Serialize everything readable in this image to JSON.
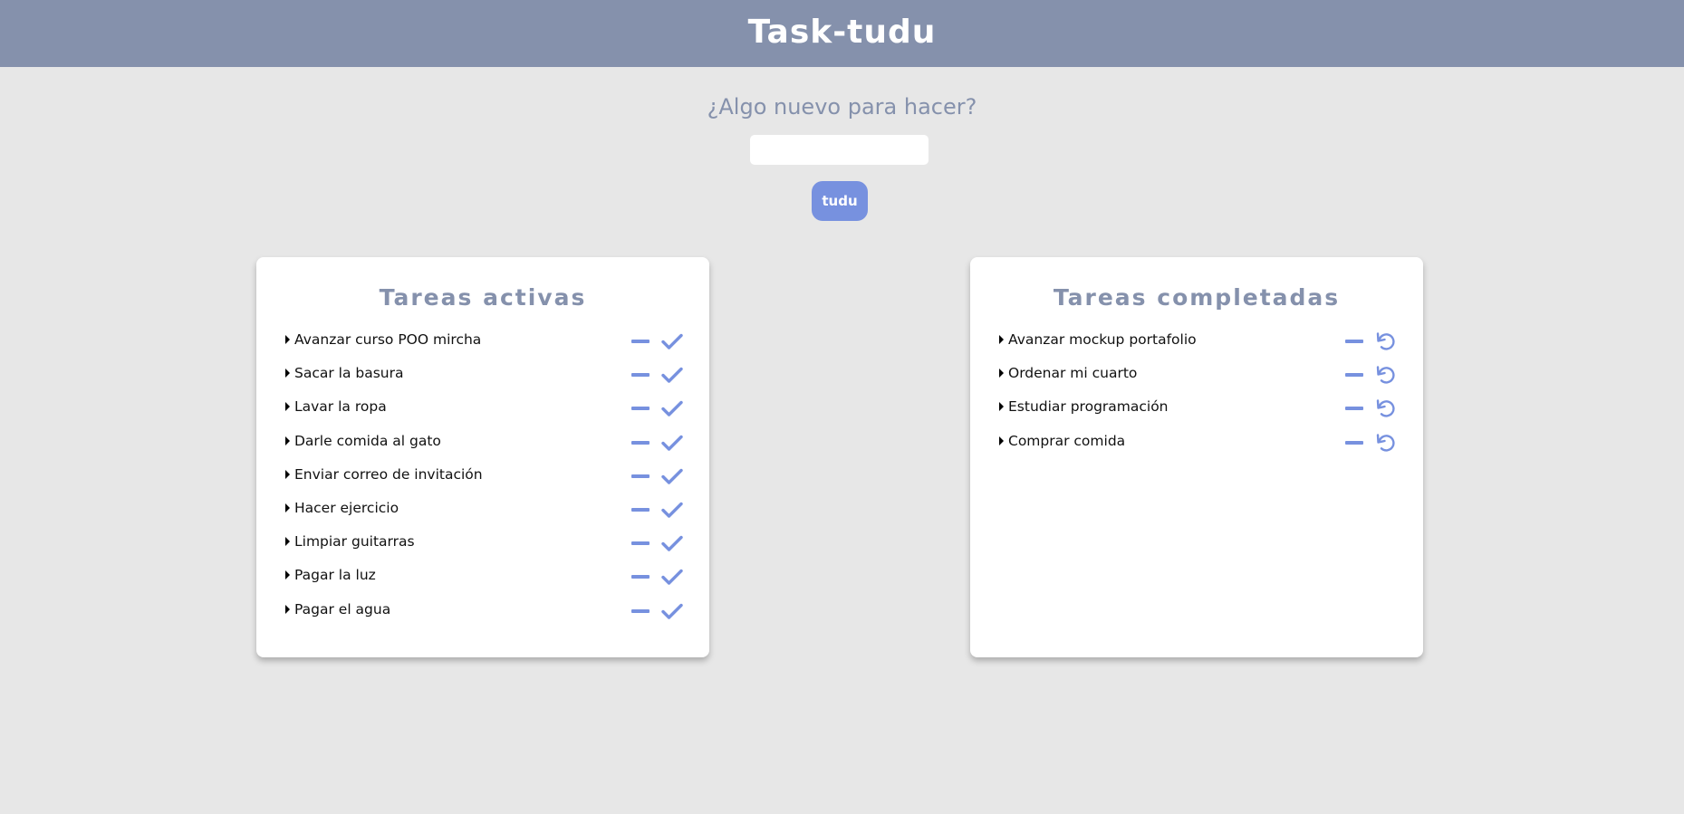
{
  "header": {
    "title": "Task-tudu"
  },
  "form": {
    "prompt": "¿Algo nuevo para hacer?",
    "input_value": "",
    "input_placeholder": "",
    "submit_label": "tudu"
  },
  "active": {
    "title": "Tareas activas",
    "items": [
      {
        "label": "Avanzar curso POO mircha"
      },
      {
        "label": "Sacar la basura"
      },
      {
        "label": "Lavar la ropa"
      },
      {
        "label": "Darle comida al gato"
      },
      {
        "label": "Enviar correo de invitación"
      },
      {
        "label": "Hacer ejercicio"
      },
      {
        "label": "Limpiar guitarras"
      },
      {
        "label": "Pagar la luz"
      },
      {
        "label": "Pagar el agua"
      }
    ]
  },
  "completed": {
    "title": "Tareas completadas",
    "items": [
      {
        "label": "Avanzar mockup portafolio"
      },
      {
        "label": "Ordenar mi cuarto"
      },
      {
        "label": "Estudiar programación"
      },
      {
        "label": "Comprar comida"
      }
    ]
  },
  "icons": {
    "item_marker": "caret-right-icon",
    "remove": "minus-icon",
    "complete": "check-icon",
    "restore": "undo-icon"
  },
  "colors": {
    "header_bg": "#8591ac",
    "page_bg": "#e7e7e7",
    "accent": "#7791df",
    "title_text": "#8591ac"
  }
}
